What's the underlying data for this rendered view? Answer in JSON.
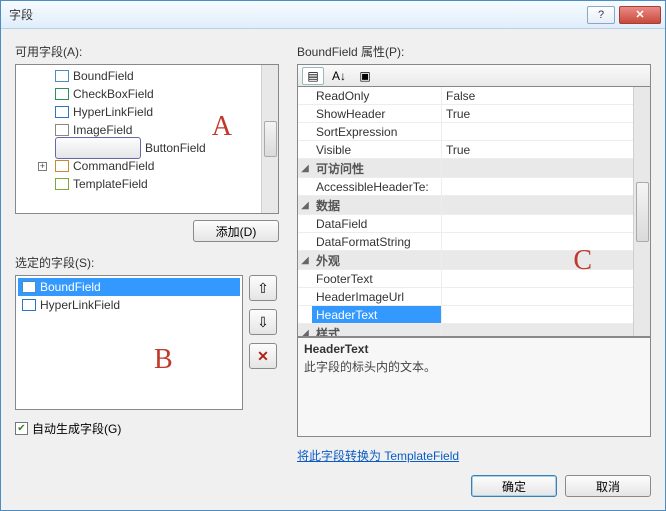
{
  "window": {
    "title": "字段",
    "help_glyph": "?",
    "close_glyph": "✕"
  },
  "labels": {
    "available_fields": "可用字段(A):",
    "selected_fields": "选定的字段(S):",
    "properties": "BoundField 属性(P):",
    "add_button": "添加(D)",
    "autogen": "自动生成字段(G)",
    "convert_link": "将此字段转换为 TemplateField",
    "ok": "确定",
    "cancel": "取消"
  },
  "markers": {
    "a": "A",
    "b": "B",
    "c": "C"
  },
  "available_tree": [
    {
      "label": "BoundField",
      "ico": "bound",
      "exp": ""
    },
    {
      "label": "CheckBoxField",
      "ico": "check",
      "exp": ""
    },
    {
      "label": "HyperLinkField",
      "ico": "link",
      "exp": ""
    },
    {
      "label": "ImageField",
      "ico": "img",
      "exp": ""
    },
    {
      "label": "ButtonField",
      "ico": "btn",
      "exp": ""
    },
    {
      "label": "CommandField",
      "ico": "cmd",
      "exp": "+"
    },
    {
      "label": "TemplateField",
      "ico": "tpl",
      "exp": ""
    }
  ],
  "selected_list": [
    {
      "label": "BoundField",
      "ico": "bound",
      "selected": true
    },
    {
      "label": "HyperLinkField",
      "ico": "link",
      "selected": false
    }
  ],
  "side_buttons": {
    "up": "⇧",
    "down": "⇩",
    "delete": "✕"
  },
  "autogen_checked": "✔",
  "pg_toolbar": {
    "categorized": "▤",
    "sort": "A↓",
    "pages": "▣"
  },
  "property_rows": [
    {
      "type": "prop",
      "name": "ReadOnly",
      "value": "False"
    },
    {
      "type": "prop",
      "name": "ShowHeader",
      "value": "True"
    },
    {
      "type": "prop",
      "name": "SortExpression",
      "value": ""
    },
    {
      "type": "prop",
      "name": "Visible",
      "value": "True"
    },
    {
      "type": "cat",
      "name": "可访问性",
      "value": ""
    },
    {
      "type": "prop",
      "name": "AccessibleHeaderTe:",
      "value": ""
    },
    {
      "type": "cat",
      "name": "数据",
      "value": ""
    },
    {
      "type": "prop",
      "name": "DataField",
      "value": ""
    },
    {
      "type": "prop",
      "name": "DataFormatString",
      "value": ""
    },
    {
      "type": "cat",
      "name": "外观",
      "value": ""
    },
    {
      "type": "prop",
      "name": "FooterText",
      "value": ""
    },
    {
      "type": "prop",
      "name": "HeaderImageUrl",
      "value": ""
    },
    {
      "type": "prop",
      "name": "HeaderText",
      "value": "",
      "selected": true
    },
    {
      "type": "cat",
      "name": "样式",
      "value": ""
    }
  ],
  "description": {
    "title": "HeaderText",
    "text": "此字段的标头内的文本。"
  }
}
